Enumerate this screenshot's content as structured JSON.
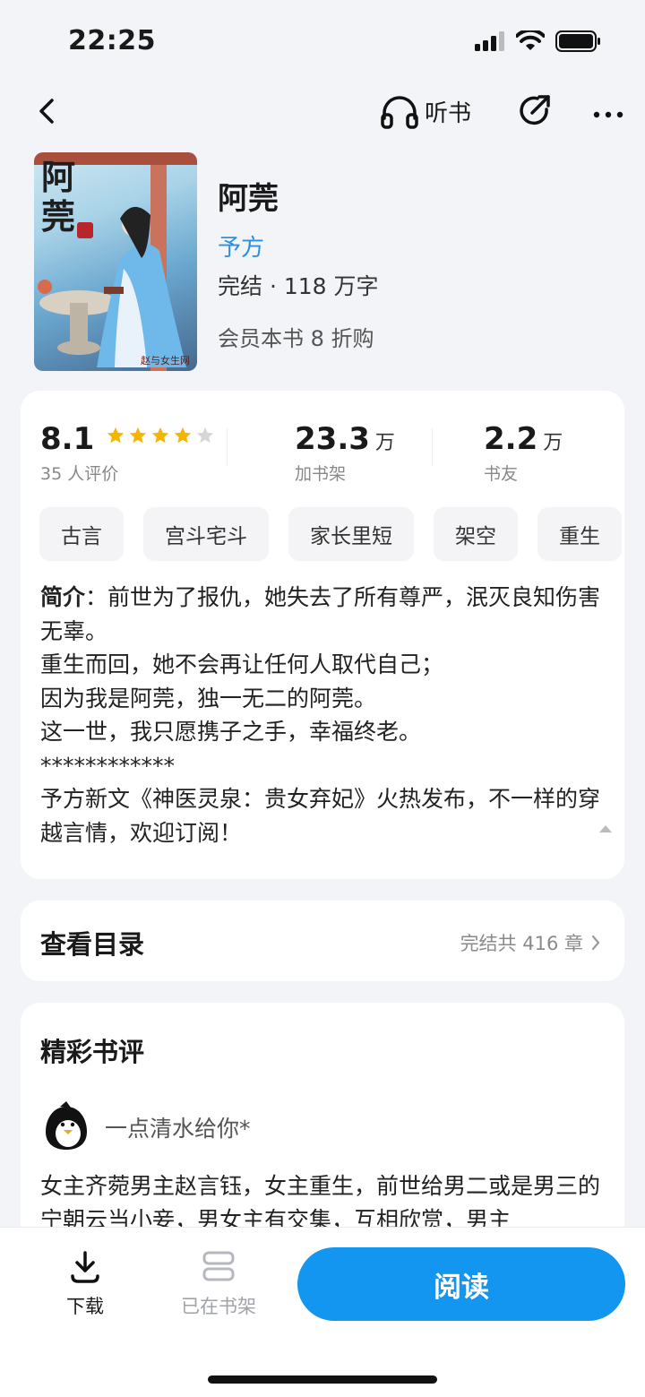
{
  "status_bar": {
    "time": "22:25"
  },
  "topbar": {
    "listen_label": "听书"
  },
  "book": {
    "cover_title": "阿莞",
    "cover_signature": "赵与女生网",
    "title": "阿莞",
    "author": "予方",
    "status": "完结 · 118 万字",
    "promo": "会员本书 8 折购"
  },
  "stats": {
    "rating": "8.1",
    "rating_stars": 4,
    "rating_count_label": "35 人评价",
    "shelf_num": "23.3",
    "shelf_unit": "万",
    "shelf_label": "加书架",
    "friends_num": "2.2",
    "friends_unit": "万",
    "friends_label": "书友"
  },
  "tags": [
    "古言",
    "宫斗宅斗",
    "家长里短",
    "架空",
    "重生"
  ],
  "intro": {
    "prefix": "简介",
    "lines": [
      "：前世为了报仇，她失去了所有尊严，泯灭良知伤害无辜。",
      "重生而回，她不会再让任何人取代自己；",
      "因为我是阿莞，独一无二的阿莞。",
      "这一世，我只愿携子之手，幸福终老。",
      "************",
      "予方新文《神医灵泉：贵女弃妃》火热发布，不一样的穿越言情，欢迎订阅！"
    ]
  },
  "toc": {
    "title": "查看目录",
    "info": "完结共 416 章"
  },
  "reviews": {
    "title": "精彩书评",
    "items": [
      {
        "name": "一点清水给你*",
        "text": "女主齐菀男主赵言钰，女主重生，前世给男二或是男三的宁朝云当小妾，男女主有交集，互相欣赏，男主"
      }
    ]
  },
  "bottom_bar": {
    "download_label": "下载",
    "shelf_label": "已在书架",
    "read_label": "阅读"
  },
  "colors": {
    "accent": "#1296f0",
    "author_link": "#2b8fe6",
    "star": "#f5b400"
  }
}
